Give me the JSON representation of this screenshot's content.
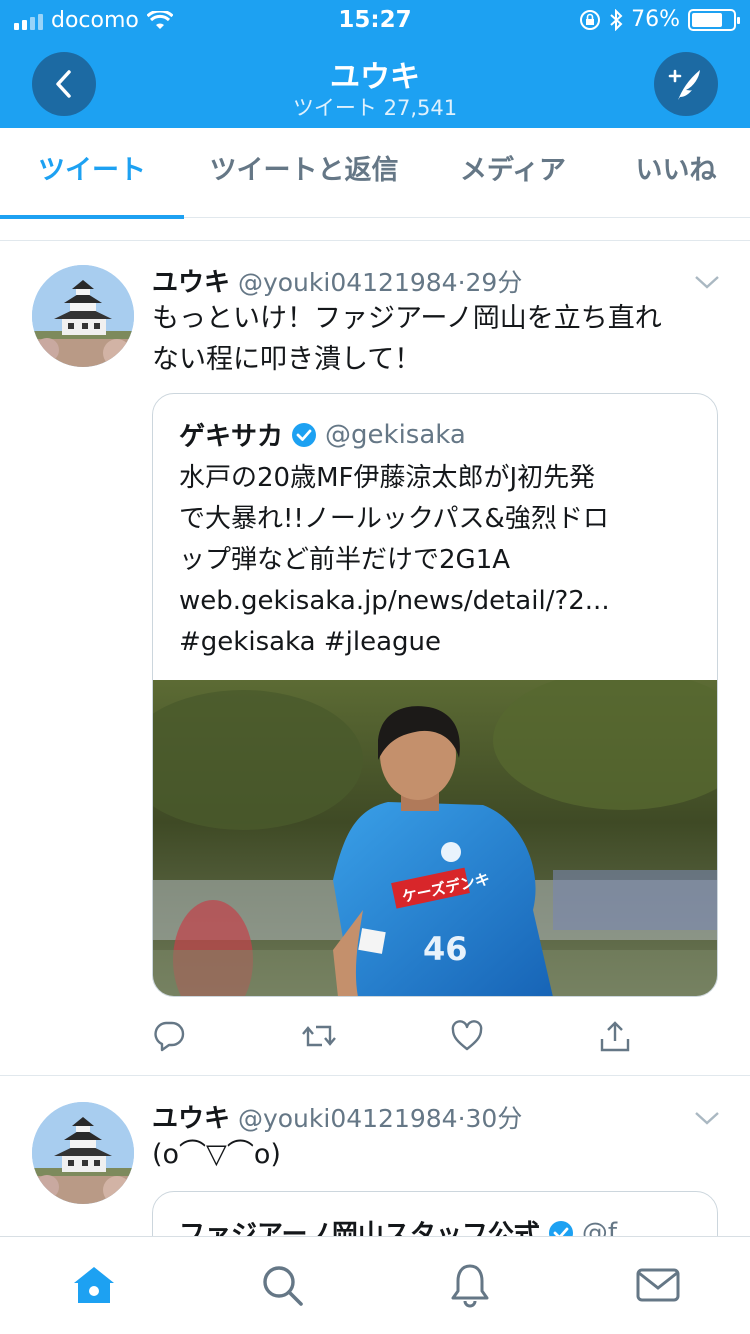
{
  "status": {
    "carrier": "docomo",
    "time": "15:27",
    "battery": "76%",
    "battery_level": 0.76
  },
  "header": {
    "title": "ユウキ",
    "subtitle": "ツイート 27,541"
  },
  "tabs": [
    {
      "label": "ツイート",
      "active": true
    },
    {
      "label": "ツイートと返信",
      "active": false
    },
    {
      "label": "メディア",
      "active": false
    },
    {
      "label": "いいね",
      "active": false
    }
  ],
  "tweets": [
    {
      "name": "ユウキ",
      "handle": "@youki04121984",
      "dot": "·",
      "time": "29分",
      "text_lines": [
        "もっといけ！ファジアーノ岡山を立ち直れ",
        "ない程に叩き潰して！"
      ],
      "quote": {
        "name": "ゲキサカ",
        "handle": "@gekisaka",
        "lines": [
          "水戸の20歳MF伊藤涼太郎がJ初先発",
          "で大暴れ!!ノールックパス&強烈ドロ",
          "ップ弾など前半だけで2G1A",
          "web.gekisaka.jp/news/detail/?2...",
          "#gekisaka #jleague"
        ],
        "image_text": "ケーズデンキ",
        "jersey_number": "46"
      }
    },
    {
      "name": "ユウキ",
      "handle": "@youki04121984",
      "dot": "·",
      "time": "30分",
      "text_lines": [
        "(o⌒▽⌒o)"
      ],
      "quote": {
        "name": "ファジアーノ岡山スタッフ公式",
        "handle": "@f"
      }
    }
  ],
  "colors": {
    "brand": "#1da1f2",
    "text": "#14171a",
    "muted": "#657786",
    "border": "#e1e8ed"
  },
  "icons": {
    "back": "chevron-left-icon",
    "compose": "compose-icon",
    "caret": "chevron-down-icon",
    "reply": "reply-icon",
    "retweet": "retweet-icon",
    "like": "heart-icon",
    "share": "share-icon",
    "verified": "verified-badge-icon",
    "home": "home-icon",
    "search": "search-icon",
    "notifications": "bell-icon",
    "messages": "mail-icon"
  }
}
